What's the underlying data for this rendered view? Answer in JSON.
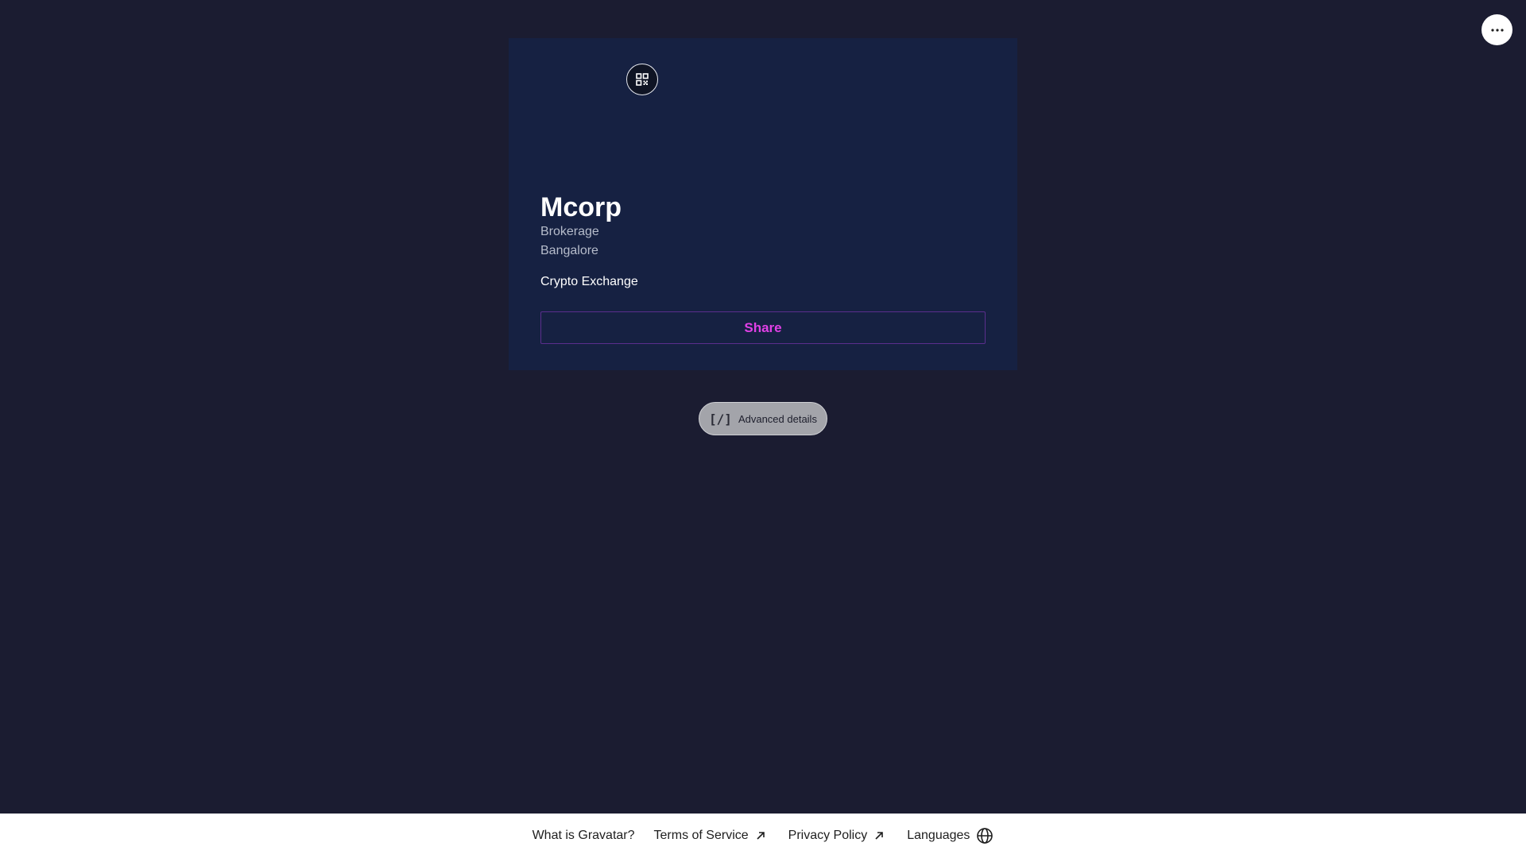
{
  "header": {
    "more_icon": "more-horizontal-icon"
  },
  "profile": {
    "qr_icon": "qr-code-icon",
    "name": "Mcorp",
    "job_title": "Brokerage",
    "location": "Bangalore",
    "description": "Crypto Exchange",
    "share_label": "Share",
    "share_color": "#e040e6",
    "card_color": "#162142"
  },
  "advanced": {
    "icon": "code-icon",
    "icon_glyph": "[/]",
    "label": "Advanced details"
  },
  "footer": {
    "links": [
      {
        "label": "What is Gravatar?"
      },
      {
        "label": "Terms of Service",
        "icon": "external-arrow-icon"
      },
      {
        "label": "Privacy Policy",
        "icon": "external-arrow-icon"
      },
      {
        "label": "Languages",
        "icon": "globe-icon"
      }
    ]
  },
  "colors": {
    "background": "#1b1c31",
    "footer_background": "#ffffff"
  }
}
